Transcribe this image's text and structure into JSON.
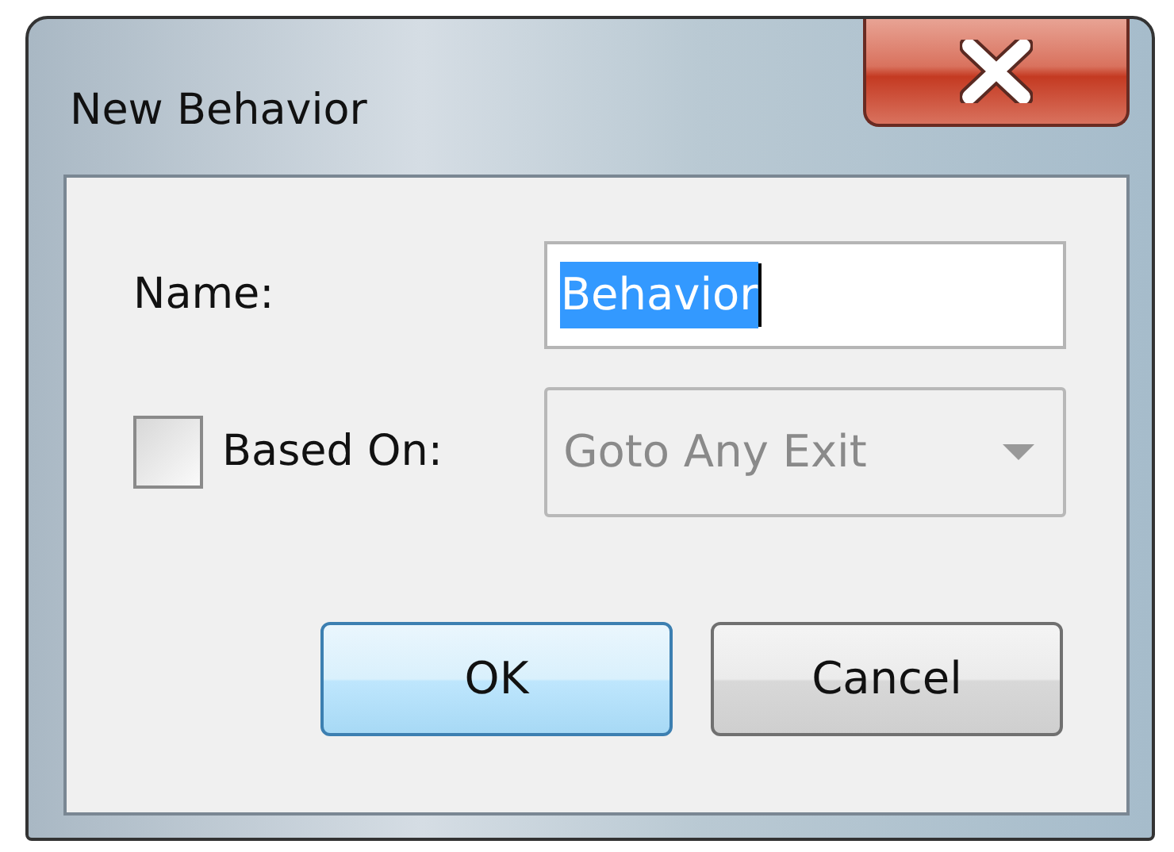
{
  "window": {
    "title": "New Behavior"
  },
  "name_field": {
    "label": "Name:",
    "value": "Behavior",
    "text_selected": true
  },
  "based_on": {
    "label": "Based On:",
    "checked": false
  },
  "based_on_dropdown": {
    "value": "Goto Any Exit",
    "disabled": true
  },
  "buttons": [
    {
      "label": "OK",
      "default": true
    },
    {
      "label": "Cancel",
      "default": false
    }
  ]
}
